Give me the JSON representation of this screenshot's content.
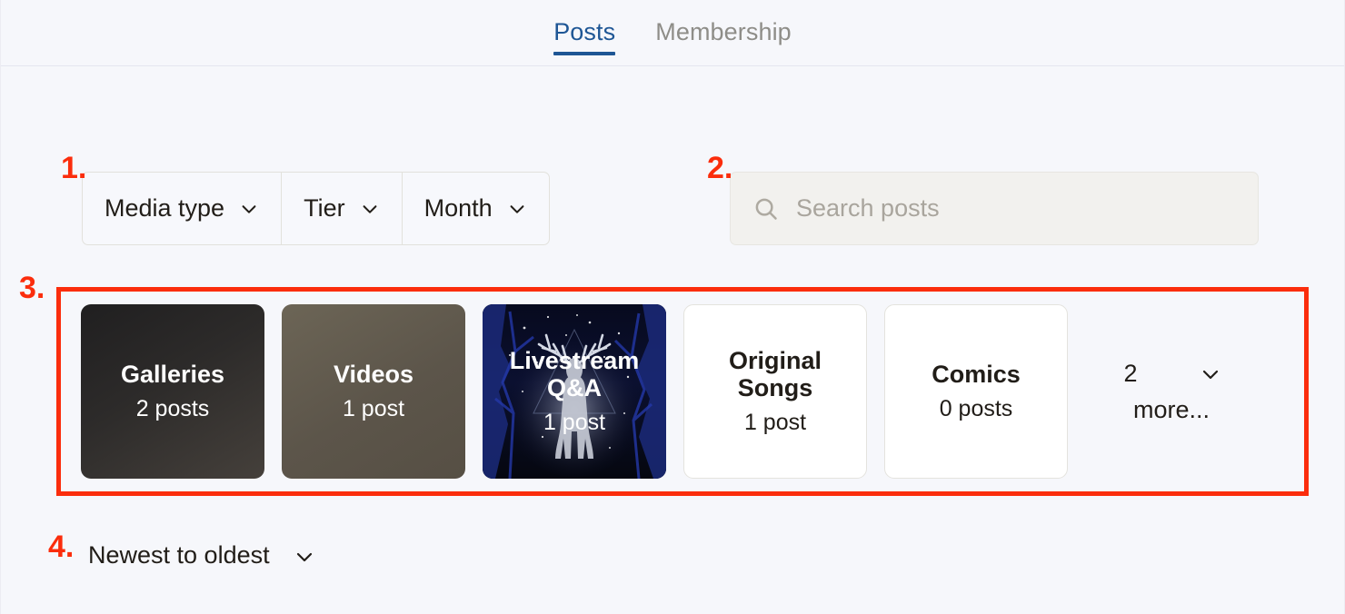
{
  "tabs": [
    {
      "label": "Posts",
      "active": true
    },
    {
      "label": "Membership",
      "active": false
    }
  ],
  "filters": {
    "segments": [
      {
        "label": "Media type",
        "icon": "chevron-down-icon"
      },
      {
        "label": "Tier",
        "icon": "chevron-down-icon"
      },
      {
        "label": "Month",
        "icon": "chevron-down-icon"
      }
    ]
  },
  "search": {
    "icon": "search-icon",
    "placeholder": "Search posts",
    "value": ""
  },
  "collections": {
    "cards": [
      {
        "title": "Galleries",
        "count": "2 posts",
        "style": "dark galleries"
      },
      {
        "title": "Videos",
        "count": "1 post",
        "style": "dark videos"
      },
      {
        "title": "Livestream Q&A",
        "count": "1 post",
        "style": "dark livestream"
      },
      {
        "title": "Original Songs",
        "count": "1 post",
        "style": "light"
      },
      {
        "title": "Comics",
        "count": "0 posts",
        "style": "light"
      }
    ],
    "more": {
      "count": "2",
      "label": "more...",
      "icon": "chevron-down-icon"
    }
  },
  "sort": {
    "label": "Newest to oldest",
    "icon": "chevron-down-icon"
  },
  "annotations": [
    {
      "id": "m1",
      "text": "1."
    },
    {
      "id": "m2",
      "text": "2."
    },
    {
      "id": "m3",
      "text": "3."
    },
    {
      "id": "m4",
      "text": "4."
    }
  ],
  "colors": {
    "background": "#f6f7fb",
    "accent_blue": "#1e5695",
    "annotation_red": "#fb2d0c",
    "muted_text": "#8e8d88",
    "card_light_bg": "#ffffff"
  }
}
